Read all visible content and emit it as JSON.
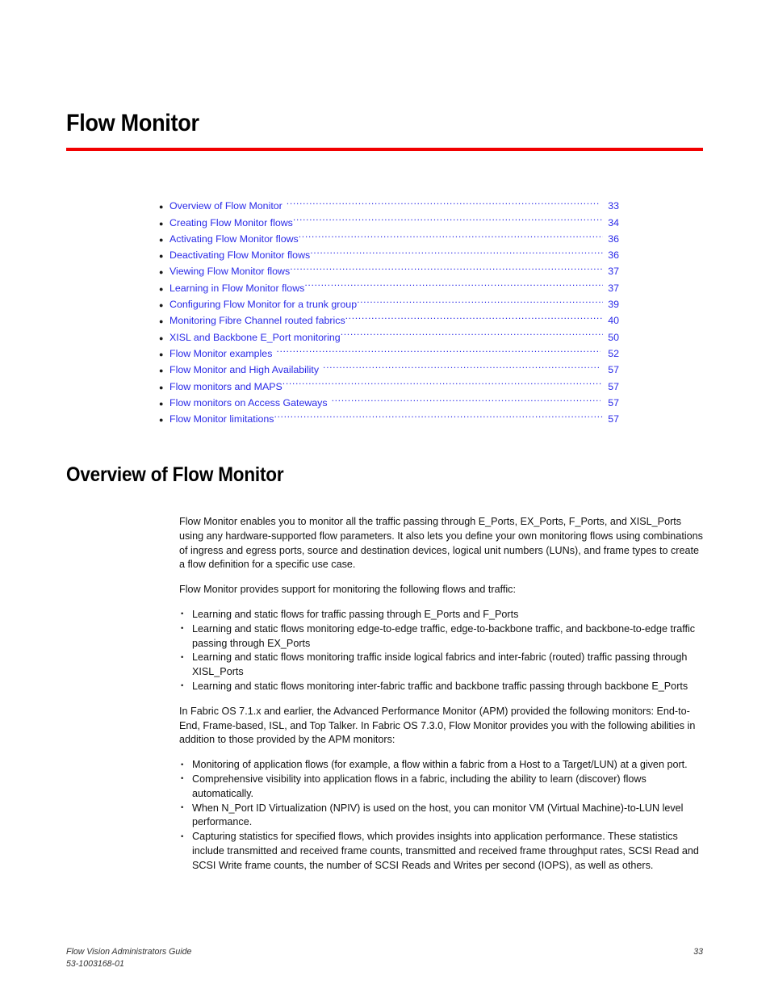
{
  "chapter": {
    "title": "Flow Monitor",
    "rule_color": "#f20000"
  },
  "toc": {
    "link_color": "#2a2ae8",
    "entries": [
      {
        "label": "Overview of Flow Monitor",
        "page": "33"
      },
      {
        "label": "Creating Flow Monitor flows",
        "page": "34"
      },
      {
        "label": "Activating Flow Monitor flows",
        "page": "36"
      },
      {
        "label": "Deactivating Flow Monitor flows",
        "page": "36"
      },
      {
        "label": "Viewing Flow Monitor flows",
        "page": "37"
      },
      {
        "label": "Learning in Flow Monitor flows",
        "page": "37"
      },
      {
        "label": "Configuring Flow Monitor for a trunk group",
        "page": "39"
      },
      {
        "label": "Monitoring Fibre Channel routed fabrics",
        "page": "40"
      },
      {
        "label": "XISL and Backbone E_Port monitoring",
        "page": "50"
      },
      {
        "label": "Flow Monitor examples",
        "page": "52"
      },
      {
        "label": "Flow Monitor and High Availability",
        "page": "57"
      },
      {
        "label": "Flow monitors and MAPS",
        "page": "57"
      },
      {
        "label": "Flow monitors on Access Gateways",
        "page": "57"
      },
      {
        "label": "Flow Monitor limitations",
        "page": "57"
      }
    ]
  },
  "section": {
    "heading": "Overview of Flow Monitor",
    "paragraph_1": "Flow Monitor enables you to monitor all the traffic passing through E_Ports, EX_Ports, F_Ports, and XISL_Ports using any hardware-supported flow parameters. It also lets you define your own monitoring flows using combinations of ingress and egress ports, source and destination devices, logical unit numbers (LUNs), and frame types to create a flow definition for a specific use case.",
    "paragraph_2": "Flow Monitor provides support for monitoring the following flows and traffic:",
    "bullets_1": [
      "Learning and static flows for traffic passing through E_Ports and F_Ports",
      "Learning and static flows monitoring edge-to-edge traffic, edge-to-backbone traffic, and backbone-to-edge traffic passing through EX_Ports",
      "Learning and static flows monitoring traffic inside logical fabrics and inter-fabric (routed) traffic passing through XISL_Ports",
      "Learning and static flows monitoring inter-fabric traffic and backbone traffic passing through backbone E_Ports"
    ],
    "paragraph_3": "In Fabric OS 7.1.x and earlier, the Advanced Performance Monitor (APM) provided the following monitors: End-to-End, Frame-based, ISL, and Top Talker. In Fabric OS 7.3.0, Flow Monitor provides you with the following abilities in addition to those provided by the APM monitors:",
    "bullets_2": [
      "Monitoring of application flows (for example, a flow within a fabric from a Host to a Target/LUN) at a given port.",
      "Comprehensive visibility into application flows in a fabric, including the ability to learn (discover) flows automatically.",
      "When N_Port ID Virtualization (NPIV) is used on the host, you can monitor VM (Virtual Machine)-to-LUN level performance.",
      "Capturing statistics for specified flows, which provides insights into application performance. These statistics include transmitted and received frame counts, transmitted and received frame throughput rates, SCSI Read and SCSI Write frame counts, the number of SCSI Reads and Writes per second (IOPS), as well as others."
    ]
  },
  "footer": {
    "guide_title": "Flow Vision Administrators Guide",
    "document_number": "53-1003168-01",
    "page_number": "33"
  }
}
